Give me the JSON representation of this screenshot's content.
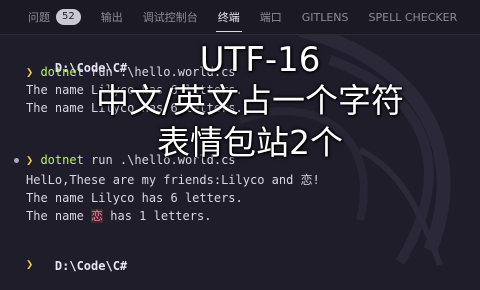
{
  "tabs": [
    {
      "label": "问题",
      "badge": "52"
    },
    {
      "label": "输出"
    },
    {
      "label": "调试控制台"
    },
    {
      "label": "终端",
      "active": true
    },
    {
      "label": "端口"
    },
    {
      "label": "GITLENS"
    },
    {
      "label": "SPELL CHECKER"
    }
  ],
  "terminal": {
    "prompt1": "D:\\Code\\C#",
    "cmd1_name": "dotnet",
    "cmd1_args": " run .\\hello.world.cs",
    "out1a": "The name Lilyco has 6 letters.",
    "out1b": "The name Lilyco has 6 letters.",
    "prompt2": "D:\\Code\\C#",
    "cmd2_name": "dotnet",
    "cmd2_args": " run .\\hello.world.cs",
    "out2a": "HelLo,These are my friends:Lilyco and 恋!",
    "out2b": "The name Lilyco has 6 letters.",
    "out2c_pre": "The name ",
    "out2c_hl": "恋",
    "out2c_post": " has 1 letters.",
    "prompt3": "D:\\Code\\C#"
  },
  "overlay": {
    "line1": "UTF-16",
    "line2": "中文/英文占一个字符",
    "line3": "表情包站2个"
  },
  "colors": {
    "background": "#1f1d2a",
    "command": "#b8f06a",
    "prompt_chevron": "#f2c94c",
    "highlight": "#e8838f"
  }
}
